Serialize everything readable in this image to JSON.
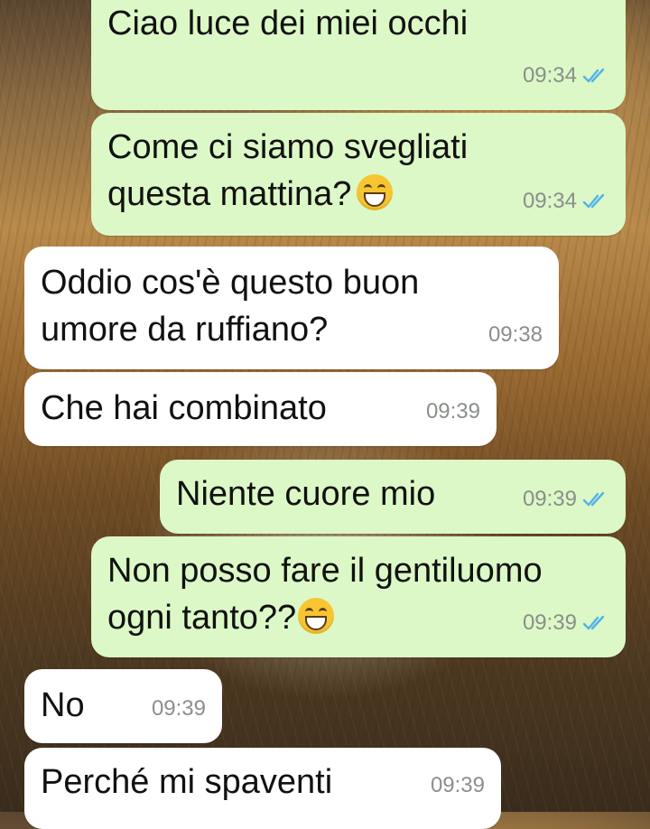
{
  "messages": [
    {
      "text": "Ciao luce dei miei occhi",
      "time": "09:34",
      "dir": "out",
      "read": true
    },
    {
      "text_lines": [
        "Come ci siamo svegliati",
        "questa mattina?"
      ],
      "emoji": "grinning-face",
      "time": "09:34",
      "dir": "out",
      "read": true
    },
    {
      "text_lines": [
        "Oddio cos'è questo buon",
        "umore da ruffiano?"
      ],
      "time": "09:38",
      "dir": "in"
    },
    {
      "text": "Che hai combinato",
      "time": "09:39",
      "dir": "in"
    },
    {
      "text": "Niente cuore mio",
      "time": "09:39",
      "dir": "out",
      "read": true
    },
    {
      "text_lines": [
        "Non posso fare il gentiluomo",
        "ogni tanto??"
      ],
      "emoji": "grinning-face",
      "time": "09:39",
      "dir": "out",
      "read": true
    },
    {
      "text": "No",
      "time": "09:39",
      "dir": "in"
    },
    {
      "text": "Perché mi spaventi",
      "time": "09:39",
      "dir": "in"
    }
  ],
  "colors": {
    "outgoing_bubble": "#dcf8c6",
    "incoming_bubble": "#ffffff",
    "timestamp": "#8a8f8a",
    "read_ticks": "#4fb3e8"
  },
  "icons": {
    "read_receipt": "double-check-icon",
    "emoji": "grinning-face-emoji"
  }
}
